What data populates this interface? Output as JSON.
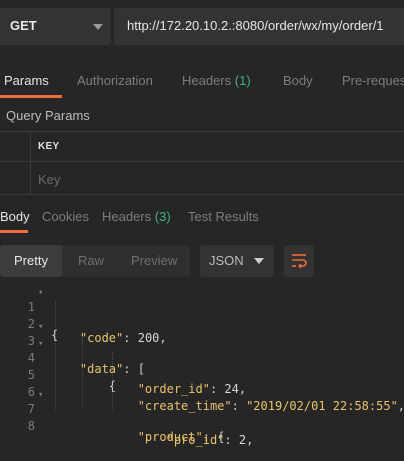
{
  "request": {
    "method": "GET",
    "url": "http://172.20.10.2.:8080/order/wx/my/order/1"
  },
  "request_tabs": [
    {
      "label": "Params",
      "count": ""
    },
    {
      "label": "Authorization",
      "count": ""
    },
    {
      "label": "Headers",
      "count": "(1)"
    },
    {
      "label": "Body",
      "count": ""
    },
    {
      "label": "Pre-reques",
      "count": ""
    }
  ],
  "query_params": {
    "title": "Query Params",
    "key_header": "KEY",
    "key_placeholder": "Key"
  },
  "response_tabs": [
    {
      "label": "Body",
      "count": ""
    },
    {
      "label": "Cookies",
      "count": ""
    },
    {
      "label": "Headers",
      "count": "(3)"
    },
    {
      "label": "Test Results",
      "count": ""
    }
  ],
  "view": {
    "modes": [
      "Pretty",
      "Raw",
      "Preview"
    ],
    "active": "Pretty",
    "format": "JSON",
    "wrap_icon": "wrap-lines-icon"
  },
  "code_lines": [
    {
      "n": "1",
      "fold": true
    },
    {
      "n": "2",
      "fold": false
    },
    {
      "n": "3",
      "fold": true
    },
    {
      "n": "4",
      "fold": true
    },
    {
      "n": "5",
      "fold": false
    },
    {
      "n": "6",
      "fold": false
    },
    {
      "n": "7",
      "fold": true
    },
    {
      "n": "8",
      "fold": false
    }
  ],
  "code_tokens": {
    "l1": "{",
    "l2_key": "\"code\"",
    "l2_val": "200",
    "l3_key": "\"data\"",
    "l3_rest": "[",
    "l4": "{",
    "l5_key": "\"order_id\"",
    "l5_val": "24",
    "l6_key": "\"create_time\"",
    "l6_val": "\"2019/02/01 22:58:55\"",
    "l7_key": "\"product\"",
    "l7_rest": "{",
    "l8_key": "\"pro_id\"",
    "l8_val": "2"
  },
  "colors": {
    "accent": "#f26b3a",
    "count_green": "#3fb37f",
    "json_string": "#e8c36a",
    "background": "#262626"
  }
}
